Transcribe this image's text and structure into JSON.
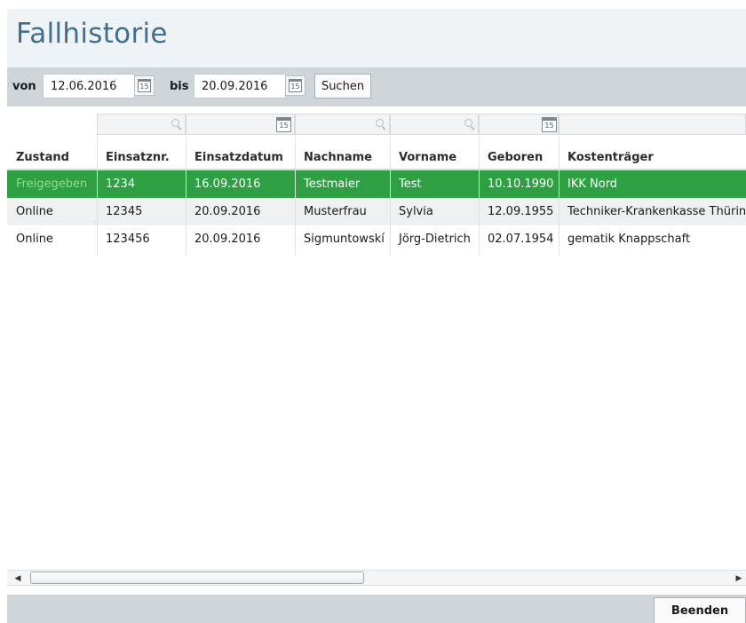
{
  "title": "Fallhistorie",
  "filter": {
    "from_label": "von",
    "from_value": "12.06.2016",
    "to_label": "bis",
    "to_value": "20.09.2016",
    "search_label": "Suchen",
    "calendar_day": "15"
  },
  "table": {
    "columns": [
      "Zustand",
      "Einsatznr.",
      "Einsatzdatum",
      "Nachname",
      "Vorname",
      "Geboren",
      "Kostenträger"
    ],
    "rows": [
      [
        "Freigegeben",
        "1234",
        "16.09.2016",
        "Testmaier",
        "Test",
        "10.10.1990",
        "IKK Nord"
      ],
      [
        "Online",
        "12345",
        "20.09.2016",
        "Musterfrau",
        "Sylvia",
        "12.09.1955",
        "Techniker-Krankenkasse Thüringen"
      ],
      [
        "Online",
        "123456",
        "20.09.2016",
        "Sigmuntowskí",
        "Jörg-Dietrich",
        "02.07.1954",
        "gematik Knappschaft"
      ]
    ],
    "selected_row": 0
  },
  "footer": {
    "end_label": "Beenden"
  },
  "colors": {
    "accent_title": "#3e6f8c",
    "selected_row": "#2ea043",
    "selected_status": "#8fdc8a"
  }
}
